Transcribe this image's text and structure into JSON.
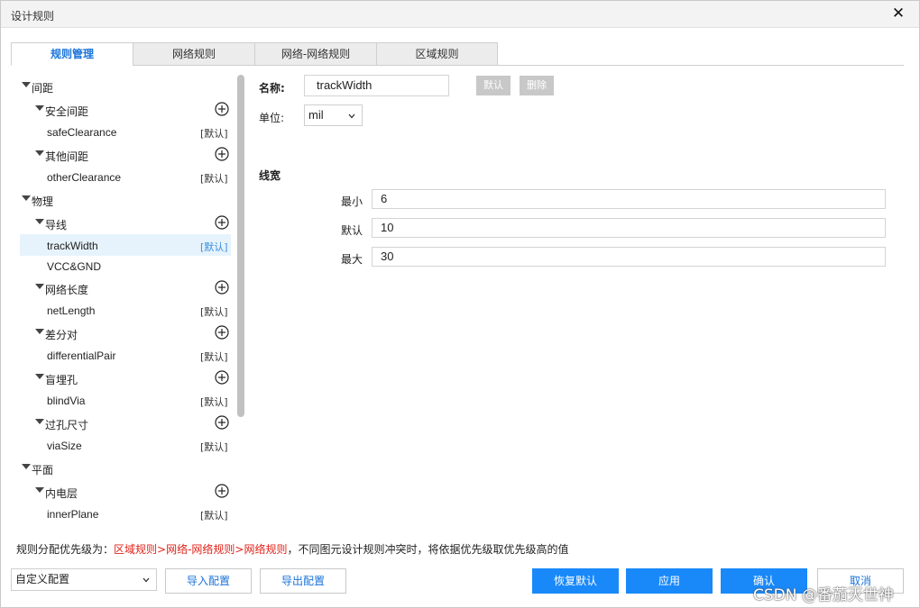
{
  "window": {
    "title": "设计规则",
    "close_glyph": "✕"
  },
  "tabs": [
    {
      "label": "规则管理",
      "active": true
    },
    {
      "label": "网络规则",
      "active": false
    },
    {
      "label": "网络-网络规则",
      "active": false
    },
    {
      "label": "区域规则",
      "active": false
    }
  ],
  "tree": {
    "default_badge": "[默认]",
    "nodes": [
      {
        "label": "间距",
        "level": 0,
        "expandable": true
      },
      {
        "label": "安全间距",
        "level": 1,
        "expandable": true,
        "add": true
      },
      {
        "label": "safeClearance",
        "level": 2,
        "badge": "[默认]"
      },
      {
        "label": "其他间距",
        "level": 1,
        "expandable": true,
        "add": true
      },
      {
        "label": "otherClearance",
        "level": 2,
        "badge": "[默认]"
      },
      {
        "label": "物理",
        "level": 0,
        "expandable": true
      },
      {
        "label": "导线",
        "level": 1,
        "expandable": true,
        "add": true
      },
      {
        "label": "trackWidth",
        "level": 2,
        "badge": "[默认]",
        "selected": true
      },
      {
        "label": "VCC&GND",
        "level": 2
      },
      {
        "label": "网络长度",
        "level": 1,
        "expandable": true,
        "add": true
      },
      {
        "label": "netLength",
        "level": 2,
        "badge": "[默认]"
      },
      {
        "label": "差分对",
        "level": 1,
        "expandable": true,
        "add": true
      },
      {
        "label": "differentialPair",
        "level": 2,
        "badge": "[默认]"
      },
      {
        "label": "盲埋孔",
        "level": 1,
        "expandable": true,
        "add": true
      },
      {
        "label": "blindVia",
        "level": 2,
        "badge": "[默认]"
      },
      {
        "label": "过孔尺寸",
        "level": 1,
        "expandable": true,
        "add": true
      },
      {
        "label": "viaSize",
        "level": 2,
        "badge": "[默认]"
      },
      {
        "label": "平面",
        "level": 0,
        "expandable": true
      },
      {
        "label": "内电层",
        "level": 1,
        "expandable": true,
        "add": true
      },
      {
        "label": "innerPlane",
        "level": 2,
        "badge": "[默认]"
      }
    ]
  },
  "form": {
    "name_label": "名称:",
    "name_value": "trackWidth",
    "default_button": "默认",
    "delete_button": "删除",
    "unit_label": "单位:",
    "unit_value": "mil",
    "section_title": "线宽",
    "min_label": "最小",
    "min_value": "6",
    "default_label": "默认",
    "default_value": "10",
    "max_label": "最大",
    "max_value": "30"
  },
  "priority": {
    "prefix": "规则分配优先级为：",
    "order": "区域规则>网络-网络规则>网络规则",
    "suffix": "，不同图元设计规则冲突时，将依据优先级取优先级高的值"
  },
  "footer": {
    "config_select": "自定义配置",
    "import_button": "导入配置",
    "export_button": "导出配置",
    "restore_button": "恢复默认",
    "apply_button": "应用",
    "ok_button": "确认",
    "cancel_button": "取消",
    "watermark": "CSDN @番茄灭世神"
  },
  "colors": {
    "accent": "#1989fa",
    "tab_active_text": "#1a73d9",
    "priority_red": "#e0231a",
    "selected_row": "#e6f3fc"
  }
}
